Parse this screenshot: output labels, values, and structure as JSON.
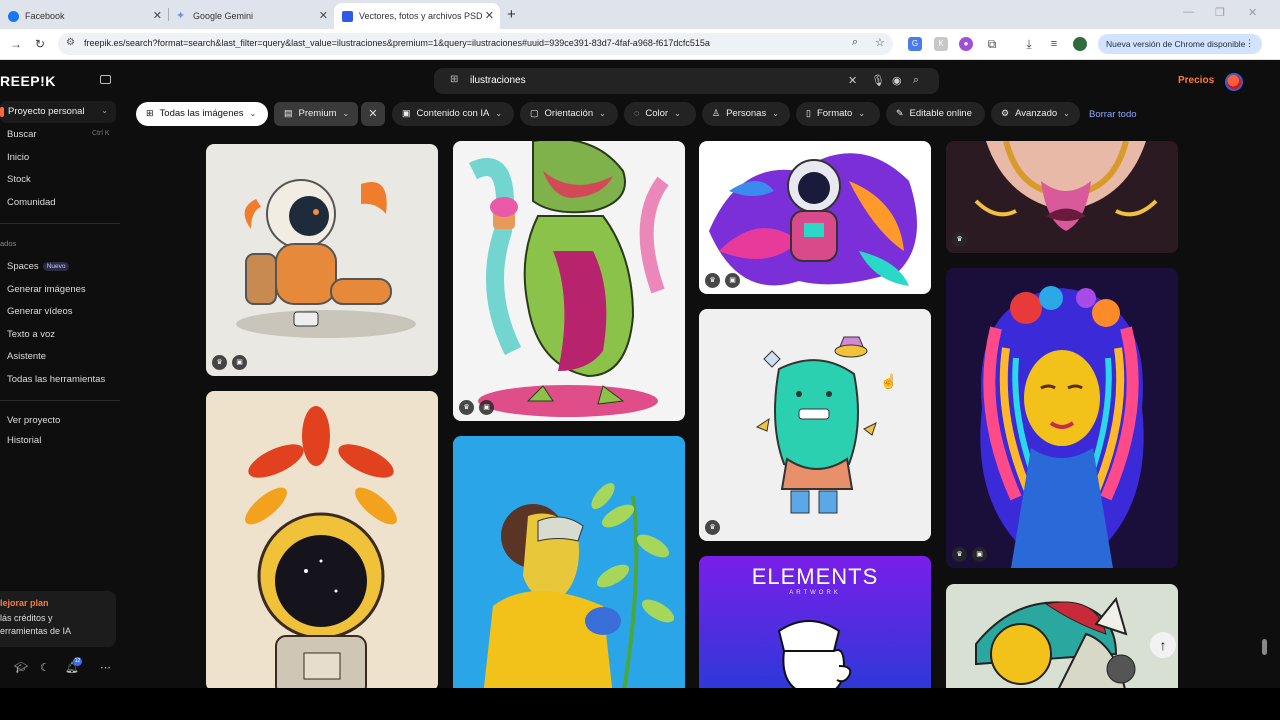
{
  "browser": {
    "tabs": [
      {
        "title": "Facebook",
        "favicon_color": "#1877f2"
      },
      {
        "title": "Google Gemini",
        "favicon_color": "#6f8ff7"
      },
      {
        "title": "Vectores, fotos y archivos PSD",
        "favicon_color": "#2d5be3"
      }
    ],
    "url": "freepik.es/search?format=search&last_filter=query&last_value=ilustraciones&premium=1&query=ilustraciones#uuid=939ce391-83d7-4faf-a968-f617dcfc515a",
    "update_button": "Nueva versión de Chrome disponible"
  },
  "app": {
    "logo": "REEP!K",
    "project": "Proyecto personal",
    "nav": {
      "buscar": "Buscar",
      "buscar_shortcut": "Ctrl K",
      "inicio": "Inicio",
      "stock": "Stock",
      "comunidad": "Comunidad",
      "section_heading": "ados",
      "spaces": "Spaces",
      "spaces_badge": "Nuevo",
      "generar_imagenes": "Generar imágenes",
      "generar_videos": "Generar vídeos",
      "texto_a_voz": "Texto a voz",
      "asistente": "Asistente",
      "todas_herramientas": "Todas las herramientas",
      "ver_proyecto": "Ver proyecto",
      "historial": "Historial"
    },
    "upgrade": {
      "title": "lejorar plan",
      "line1": "lás créditos y",
      "line2": "erramientas de IA"
    },
    "notification_count": "12",
    "search": {
      "query": "ilustraciones"
    },
    "precios": "Precios",
    "filters": {
      "todas": "Todas las imágenes",
      "premium": "Premium",
      "contenido_ia": "Contenido con IA",
      "orientacion": "Orientación",
      "color": "Color",
      "personas": "Personas",
      "formato": "Formato",
      "editable": "Editable online",
      "avanzado": "Avanzado",
      "borrar": "Borrar todo"
    },
    "cards": {
      "elements_title": "ELEMENTS",
      "elements_sub": "ARTWORK"
    }
  }
}
